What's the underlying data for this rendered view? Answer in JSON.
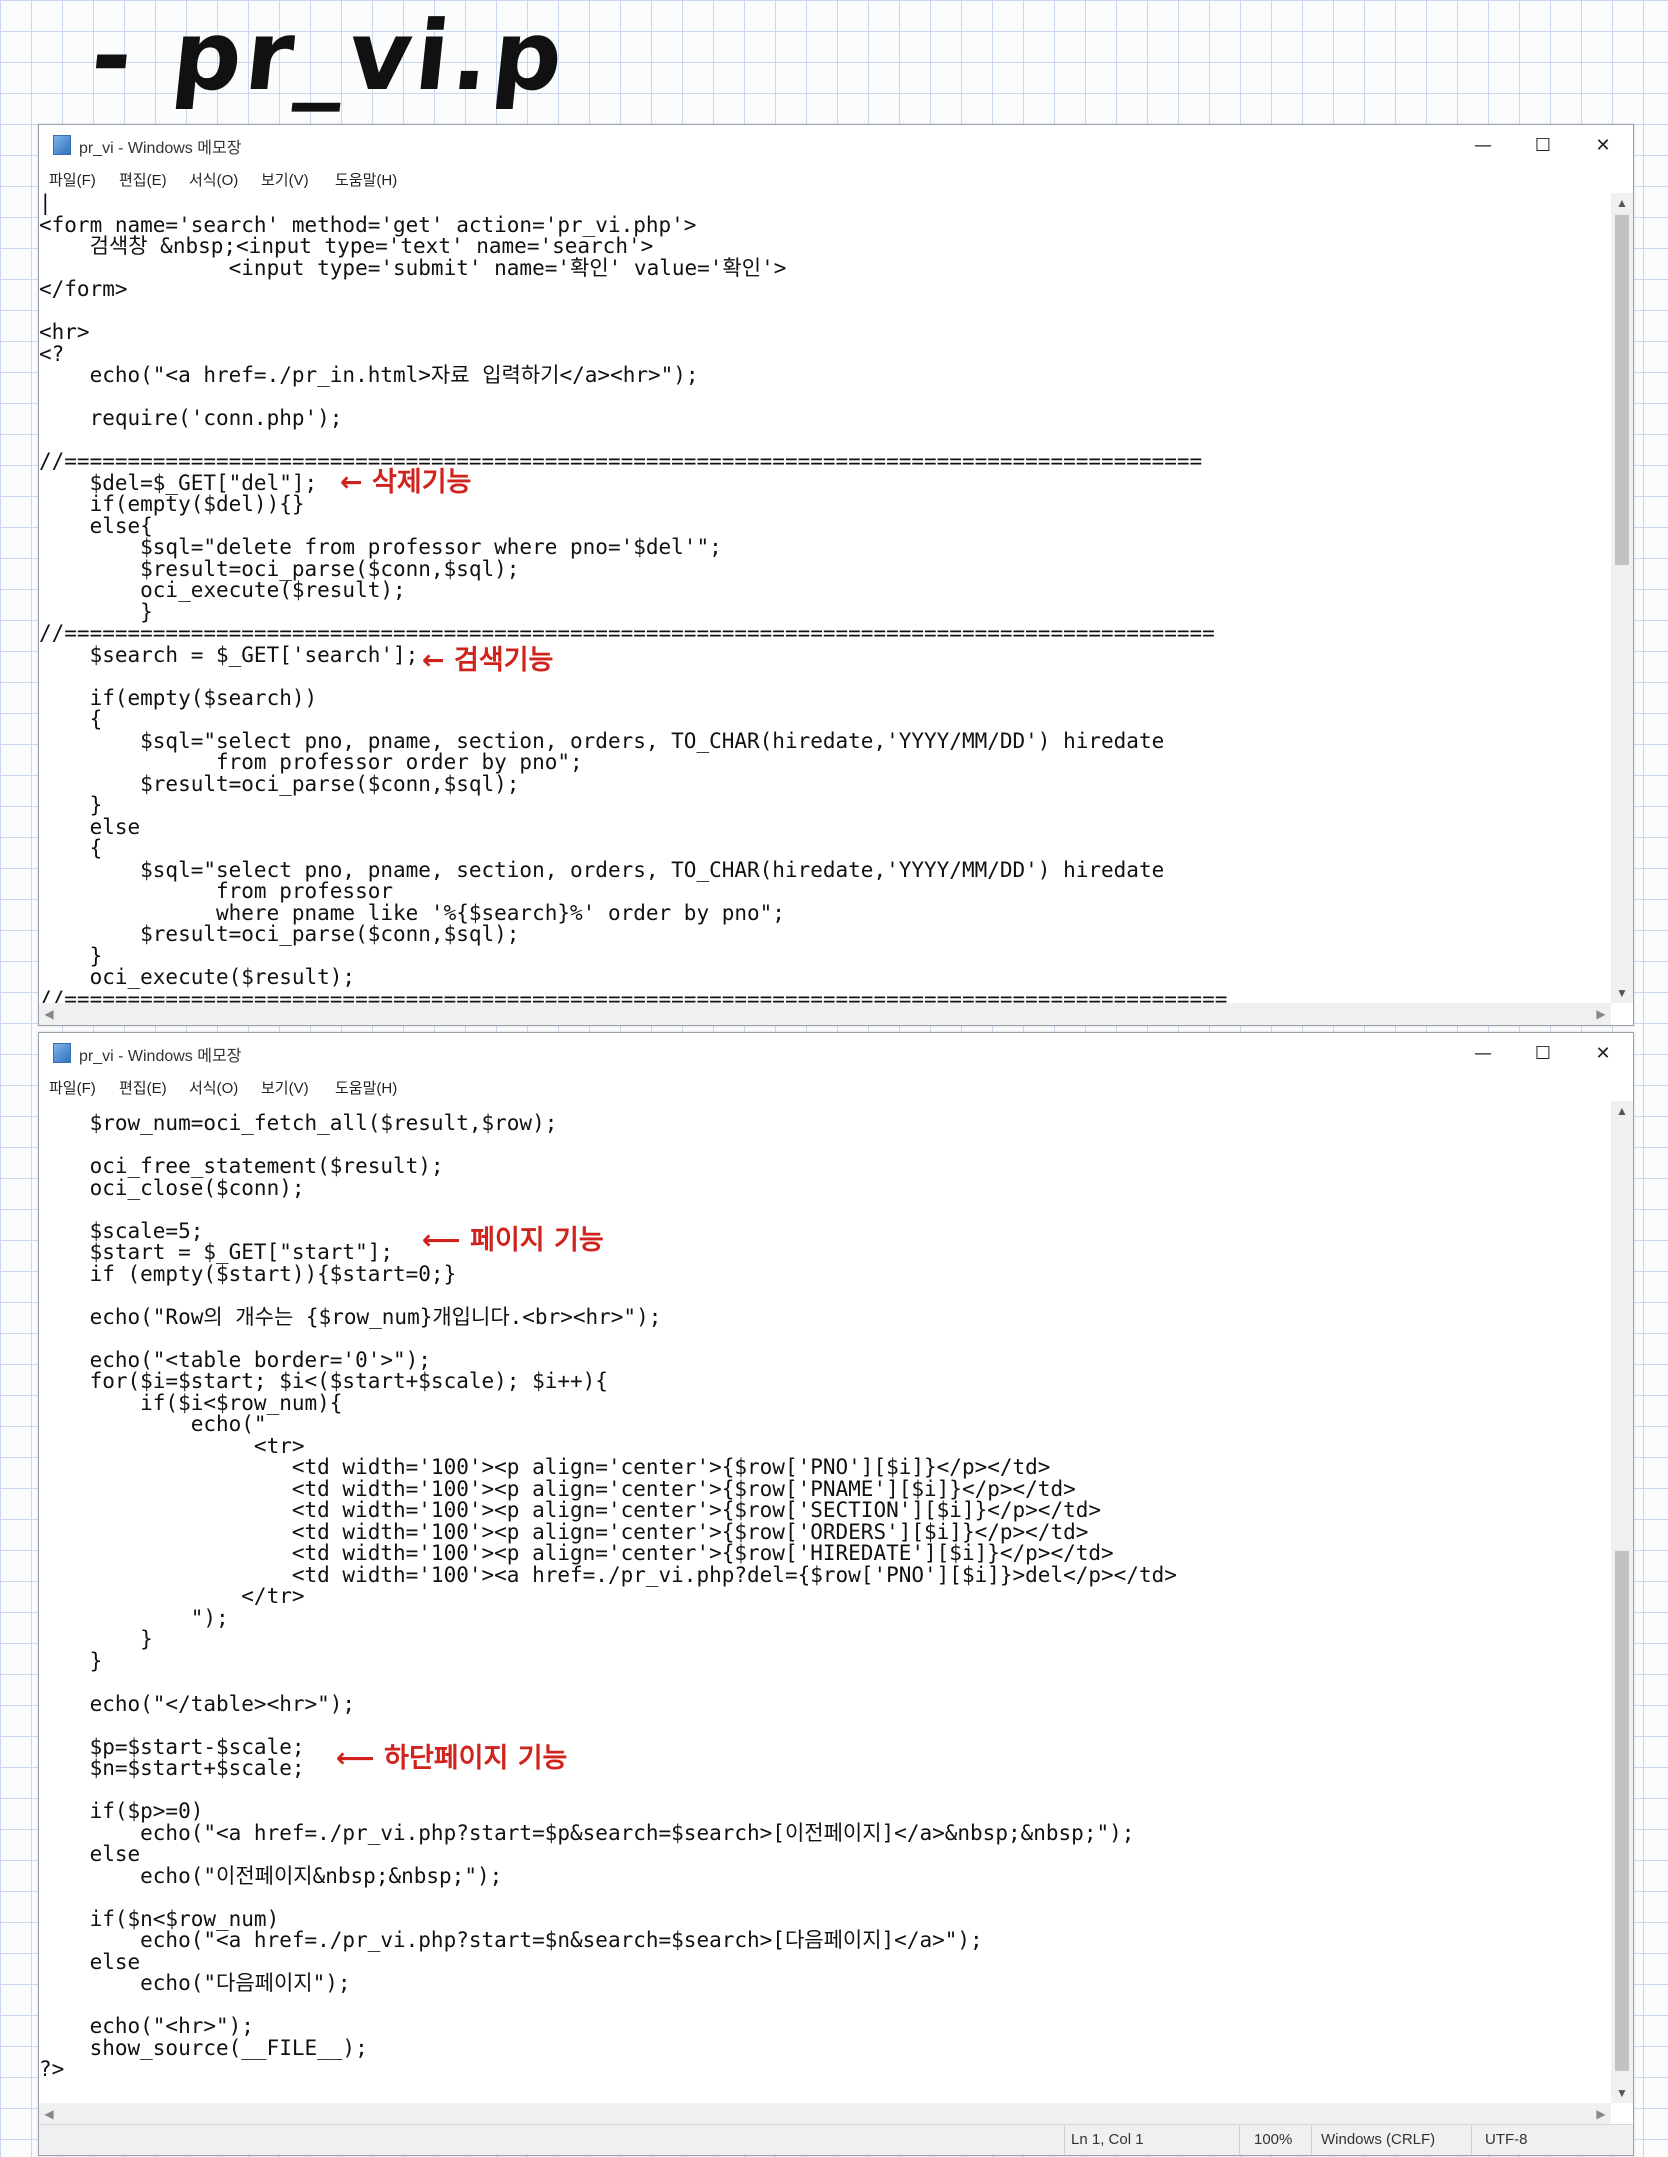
{
  "page_title": "- pr_vi.p",
  "window": {
    "title": "pr_vi - Windows 메모장",
    "controls": {
      "minimize": "—",
      "maximize": "☐",
      "close": "✕"
    },
    "menu": [
      "파일(F)",
      "편집(E)",
      "서식(O)",
      "보기(V)",
      "도움말(H)"
    ]
  },
  "editor_top": {
    "code": "|\n<form name='search' method='get' action='pr_vi.php'>\n    검색창 &nbsp;<input type='text' name='search'>\n               <input type='submit' name='확인' value='확인'>\n</form>\n\n<hr>\n<?\n    echo(\"<a href=./pr_in.html>자료 입력하기</a><hr>\");\n\n    require('conn.php');\n\n//==========================================================================================\n    $del=$_GET[\"del\"];\n    if(empty($del)){}\n    else{\n        $sql=\"delete from professor where pno='$del'\";\n        $result=oci_parse($conn,$sql);\n        oci_execute($result);\n        }\n//===========================================================================================\n    $search = $_GET['search'];\n\n    if(empty($search))\n    {\n        $sql=\"select pno, pname, section, orders, TO_CHAR(hiredate,'YYYY/MM/DD') hiredate\n              from professor order by pno\";\n        $result=oci_parse($conn,$sql);\n    }\n    else\n    {\n        $sql=\"select pno, pname, section, orders, TO_CHAR(hiredate,'YYYY/MM/DD') hiredate\n              from professor\n              where pname like '%{$search}%' order by pno\";\n        $result=oci_parse($conn,$sql);\n    }\n    oci_execute($result);\n//============================================================================================"
  },
  "editor_bottom": {
    "code": "    $row_num=oci_fetch_all($result,$row);\n\n    oci_free_statement($result);\n    oci_close($conn);\n\n    $scale=5;\n    $start = $_GET[\"start\"];\n    if (empty($start)){$start=0;}\n\n    echo(\"Row의 개수는 {$row_num}개입니다.<br><hr>\");\n\n    echo(\"<table border='0'>\");\n    for($i=$start; $i<($start+$scale); $i++){\n        if($i<$row_num){\n            echo(\"\n                 <tr>\n                    <td width='100'><p align='center'>{$row['PNO'][$i]}</p></td>\n                    <td width='100'><p align='center'>{$row['PNAME'][$i]}</p></td>\n                    <td width='100'><p align='center'>{$row['SECTION'][$i]}</p></td>\n                    <td width='100'><p align='center'>{$row['ORDERS'][$i]}</p></td>\n                    <td width='100'><p align='center'>{$row['HIREDATE'][$i]}</p></td>\n                    <td width='100'><a href=./pr_vi.php?del={$row['PNO'][$i]}>del</p></td>\n                </tr>\n            \");\n        }\n    }\n\n    echo(\"</table><hr>\");\n\n    $p=$start-$scale;\n    $n=$start+$scale;\n\n    if($p>=0)\n        echo(\"<a href=./pr_vi.php?start=$p&search=$search>[이전페이지]</a>&nbsp;&nbsp;\");\n    else\n        echo(\"이전페이지&nbsp;&nbsp;\");\n\n    if($n<$row_num)\n        echo(\"<a href=./pr_vi.php?start=$n&search=$search>[다음페이지]</a>\");\n    else\n        echo(\"다음페이지\");\n\n    echo(\"<hr>\");\n    show_source(__FILE__);\n?>"
  },
  "annotations": {
    "delete": "← 삭제기능",
    "search": "← 검색기능",
    "page": "⟵ 페이지 기능",
    "bottom_page": "⟵ 하단페이지 기능"
  },
  "status": {
    "position": "Ln 1, Col 1",
    "zoom": "100%",
    "line_ending": "Windows (CRLF)",
    "encoding": "UTF-8"
  },
  "colors": {
    "annotation": "#d0231d",
    "grid": "#c9d8ec"
  }
}
